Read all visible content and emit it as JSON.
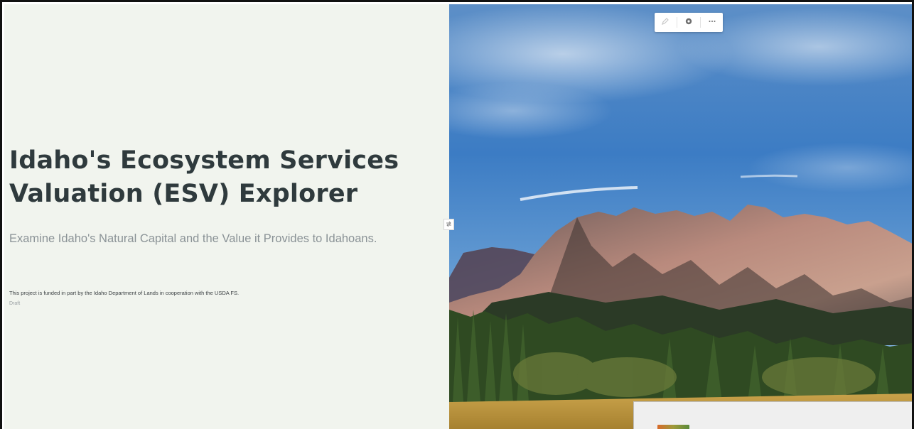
{
  "story": {
    "title": "Idaho's Ecosystem Services Valuation (ESV) Explorer",
    "subtitle": "Examine Idaho's Natural Capital and the Value it Provides to Idahoans.",
    "funding": "This project is funded in part by the Idaho Department of Lands in cooperation with the USDA FS.",
    "credit": "Draft"
  },
  "toolbar": {
    "icons": [
      "pencil-icon",
      "gear-icon",
      "more-icon"
    ]
  },
  "icons": {
    "swap_handle": "swap-icon"
  },
  "colors": {
    "panel_bg": "#f1f4ee",
    "title": "#2f3a3d",
    "subtitle": "#8a9296",
    "sky": "#3f7fc4"
  }
}
